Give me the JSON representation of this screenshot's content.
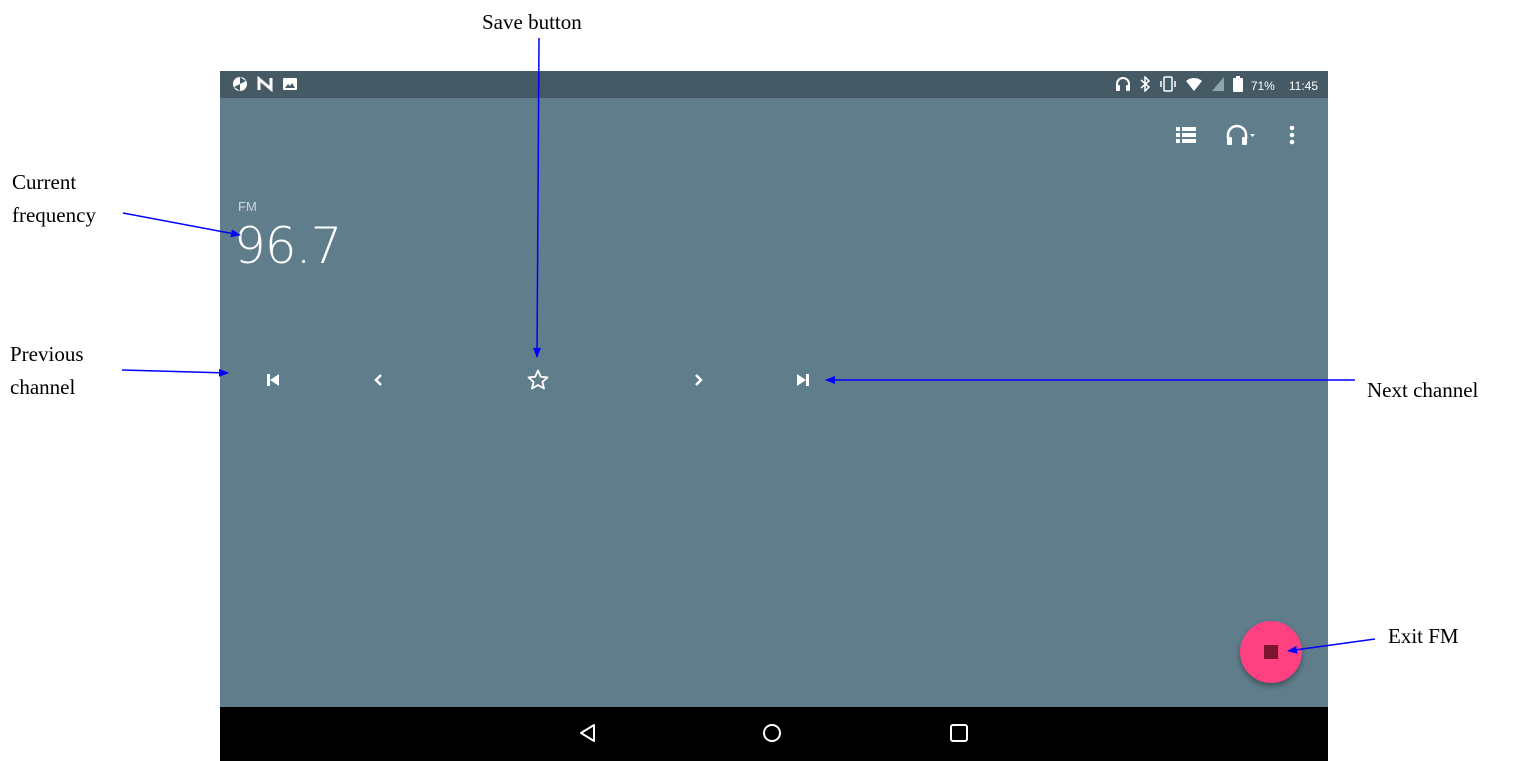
{
  "annotations": {
    "save_button": "Save button",
    "current_frequency_line1": "Current",
    "current_frequency_line2": "frequency",
    "previous_channel_line1": "Previous",
    "previous_channel_line2": "channel",
    "next_channel": "Next channel",
    "exit_fm": "Exit FM"
  },
  "status_bar": {
    "left_icons": [
      "sync-icon",
      "nfc-icon",
      "image-icon"
    ],
    "right_icons": [
      "headphones-icon",
      "bluetooth-icon",
      "vibrate-icon",
      "wifi-icon",
      "no-sim-icon",
      "battery-icon"
    ],
    "battery": "71%",
    "time": "11:45"
  },
  "toolbar": {
    "icons": [
      "station-list-icon",
      "headphones-output-icon",
      "more-options-icon"
    ]
  },
  "radio": {
    "band": "FM",
    "frequency": "96.7"
  },
  "controls": [
    "previous-station-icon",
    "seek-back-icon",
    "favorite-star-icon",
    "seek-forward-icon",
    "next-station-icon"
  ],
  "fab": {
    "icon": "stop-icon",
    "color": "#ff4081"
  },
  "nav_bar": {
    "icons": [
      "back-icon",
      "home-icon",
      "recents-icon"
    ]
  },
  "colors": {
    "background": "#607d8b",
    "status_bar": "#455a64",
    "nav_bar": "#000000",
    "arrow": "#0000ff"
  }
}
